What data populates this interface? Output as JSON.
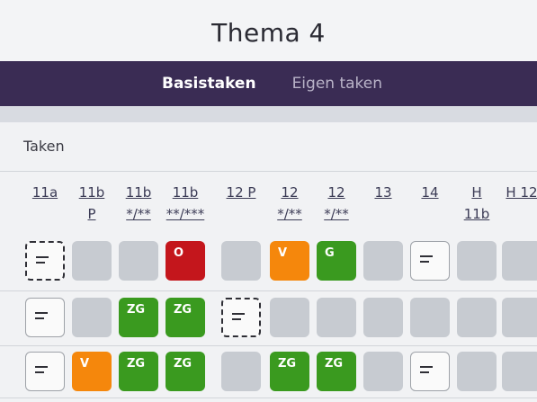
{
  "header": {
    "title": "Thema 4"
  },
  "tabs": [
    {
      "label": "Basistaken",
      "active": true
    },
    {
      "label": "Eigen taken",
      "active": false
    }
  ],
  "section": {
    "label": "Taken"
  },
  "columns": [
    {
      "line1": "11a",
      "line2": ""
    },
    {
      "line1": "11b",
      "line2": "P"
    },
    {
      "line1": "11b",
      "line2": "*/**"
    },
    {
      "line1": "11b",
      "line2": "**/***"
    },
    {
      "line1": "12 P",
      "line2": ""
    },
    {
      "line1": "12",
      "line2": "*/**"
    },
    {
      "line1": "12",
      "line2": "*/**"
    },
    {
      "line1": "13",
      "line2": ""
    },
    {
      "line1": "14",
      "line2": ""
    },
    {
      "line1": "H",
      "line2": "11b"
    },
    {
      "line1": "H 12",
      "line2": ""
    }
  ],
  "rows": [
    [
      {
        "kind": "note-dashed",
        "label": ""
      },
      {
        "kind": "empty",
        "label": ""
      },
      {
        "kind": "empty",
        "label": ""
      },
      {
        "kind": "red",
        "label": "O"
      },
      {
        "kind": "empty",
        "label": ""
      },
      {
        "kind": "orange",
        "label": "V"
      },
      {
        "kind": "green",
        "label": "G"
      },
      {
        "kind": "empty",
        "label": ""
      },
      {
        "kind": "note",
        "label": ""
      },
      {
        "kind": "empty",
        "label": ""
      },
      {
        "kind": "empty",
        "label": ""
      }
    ],
    [
      {
        "kind": "note",
        "label": ""
      },
      {
        "kind": "empty",
        "label": ""
      },
      {
        "kind": "green",
        "label": "ZG"
      },
      {
        "kind": "green",
        "label": "ZG"
      },
      {
        "kind": "note-dashed",
        "label": ""
      },
      {
        "kind": "empty",
        "label": ""
      },
      {
        "kind": "empty",
        "label": ""
      },
      {
        "kind": "empty",
        "label": ""
      },
      {
        "kind": "empty",
        "label": ""
      },
      {
        "kind": "empty",
        "label": ""
      },
      {
        "kind": "empty",
        "label": ""
      }
    ],
    [
      {
        "kind": "note",
        "label": ""
      },
      {
        "kind": "orange",
        "label": "V"
      },
      {
        "kind": "green",
        "label": "ZG"
      },
      {
        "kind": "green",
        "label": "ZG"
      },
      {
        "kind": "empty",
        "label": ""
      },
      {
        "kind": "green",
        "label": "ZG"
      },
      {
        "kind": "green",
        "label": "ZG"
      },
      {
        "kind": "empty",
        "label": ""
      },
      {
        "kind": "note",
        "label": ""
      },
      {
        "kind": "empty",
        "label": ""
      },
      {
        "kind": "empty",
        "label": ""
      }
    ]
  ]
}
